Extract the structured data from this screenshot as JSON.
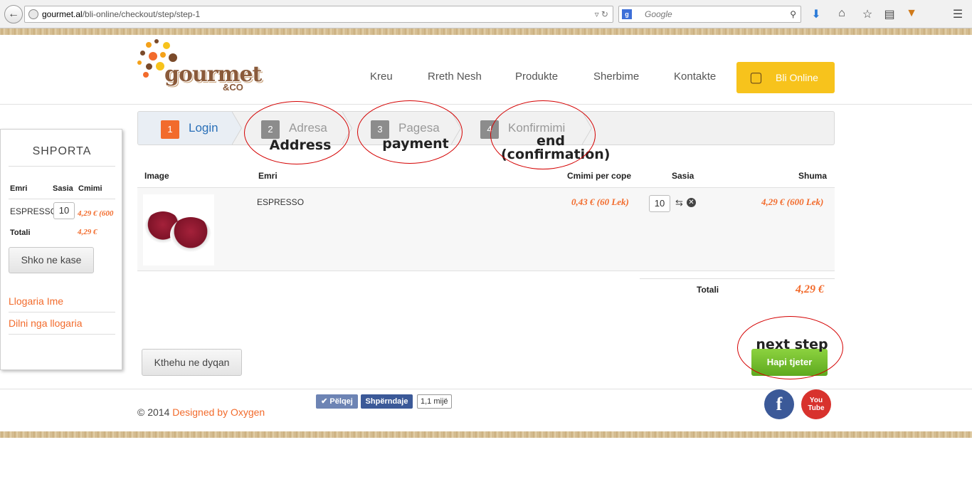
{
  "browser": {
    "url_domain": "gourmet.al",
    "url_path": "/bli-online/checkout/step/step-1",
    "search_placeholder": "Google"
  },
  "logo": {
    "word": "gourmet",
    "co": "&CO"
  },
  "nav": {
    "items": [
      "Kreu",
      "Rreth Nesh",
      "Produkte",
      "Sherbime",
      "Kontakte"
    ],
    "cta": "Bli Online"
  },
  "sidebar": {
    "title": "SHPORTA",
    "col_name": "Emri",
    "col_qty": "Sasia",
    "col_price": "Cmimi",
    "item_name": "ESPRESSO",
    "item_qty": "10",
    "item_price": "4,29 € (600",
    "total_label": "Totali",
    "total_value": "4,29 €",
    "checkout_button": "Shko ne kase",
    "links": [
      "Llogaria Ime",
      "Dilni nga llogaria"
    ]
  },
  "steps": [
    {
      "num": "1",
      "label": "Login",
      "active": true
    },
    {
      "num": "2",
      "label": "Adresa",
      "active": false
    },
    {
      "num": "3",
      "label": "Pagesa",
      "active": false
    },
    {
      "num": "4",
      "label": "Konfirmimi",
      "active": false
    }
  ],
  "table": {
    "headers": {
      "image": "Image",
      "name": "Emri",
      "unit_price": "Cmimi per cope",
      "qty": "Sasia",
      "sum": "Shuma"
    },
    "row": {
      "name": "ESPRESSO",
      "unit_price": "0,43 € (60 Lek)",
      "qty": "10",
      "sum": "4,29 € (600 Lek)"
    },
    "total_label": "Totali",
    "total_value": "4,29 €"
  },
  "buttons": {
    "back": "Kthehu ne dyqan",
    "next": "Hapi tjeter"
  },
  "annotations": {
    "address": "Address",
    "payment": "payment",
    "end_line1": "end",
    "end_line2": "(confirmation)",
    "next": "next step",
    "color": "#d40000"
  },
  "footer": {
    "copyright": "© 2014",
    "designer": "Designed by Oxygen",
    "like": "✔ Pëlqej",
    "share": "Shpërndaje",
    "count": "1,1 mijë",
    "facebook": "f",
    "youtube_top": "You",
    "youtube_bottom": "Tube"
  },
  "colors": {
    "accent_orange": "#f26b2c",
    "cta_yellow": "#f7c31c",
    "next_green": "#6fb92a",
    "facebook_blue": "#3b5998",
    "youtube_red": "#d8322d"
  }
}
